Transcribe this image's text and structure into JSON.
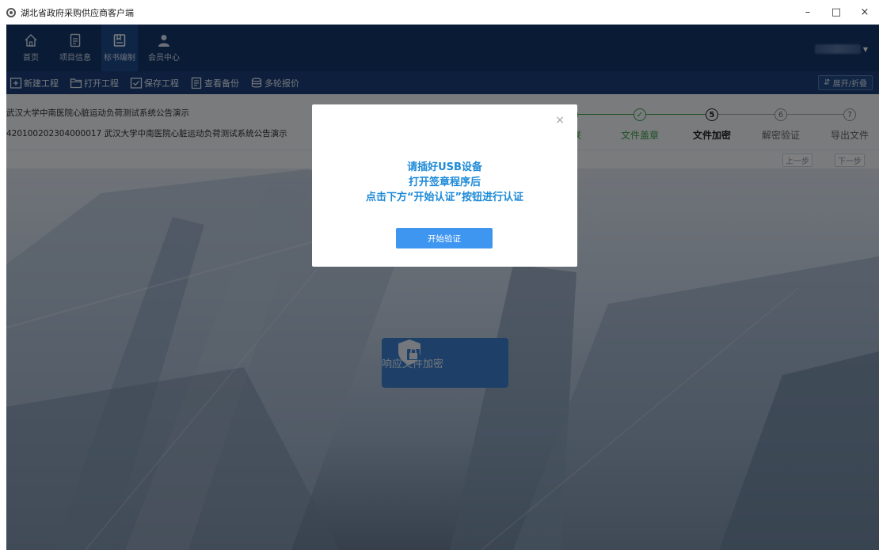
{
  "window": {
    "title": "湖北省政府采购供应商客户端",
    "controls": {
      "minimize": "–",
      "maximize": "□",
      "close": "×"
    }
  },
  "nav": {
    "items": [
      {
        "label": "首页",
        "icon": "home-icon"
      },
      {
        "label": "项目信息",
        "icon": "document-icon"
      },
      {
        "label": "标书编制",
        "icon": "book-icon",
        "active": true
      },
      {
        "label": "会员中心",
        "icon": "user-icon"
      }
    ]
  },
  "toolbar": {
    "new_project": "新建工程",
    "open_project": "打开工程",
    "save_project": "保存工程",
    "view_backup": "查看备份",
    "multi_quote": "多轮报价",
    "expand_collapse": "展开/折叠"
  },
  "project": {
    "name": "武汉大学中南医院心脏运动负荷测试系统公告演示",
    "code_line": "420100202304000017 武汉大学中南医院心脏运动负荷测试系统公告演示"
  },
  "steps": [
    {
      "number": "",
      "label": "关联",
      "status": "done"
    },
    {
      "number": "",
      "label": "文件盖章",
      "status": "done"
    },
    {
      "number": "5",
      "label": "文件加密",
      "status": "current"
    },
    {
      "number": "6",
      "label": "解密验证",
      "status": "todo"
    },
    {
      "number": "7",
      "label": "导出文件",
      "status": "todo"
    }
  ],
  "step_nav": {
    "prev": "上一步",
    "next": "下一步"
  },
  "encrypt_button": {
    "label": "响应文件加密",
    "icon": "shield-lock-icon"
  },
  "modal": {
    "line1": "请插好USB设备",
    "line2": "打开签章程序后",
    "line3": "点击下方“开始认证”按钮进行认证",
    "button": "开始验证",
    "close": "×"
  },
  "colors": {
    "header": "#13366b",
    "toolbar": "#1a3f78",
    "step_done": "#3aa34a",
    "modal_text": "#1d8ad8",
    "modal_button": "#3f96f0"
  }
}
